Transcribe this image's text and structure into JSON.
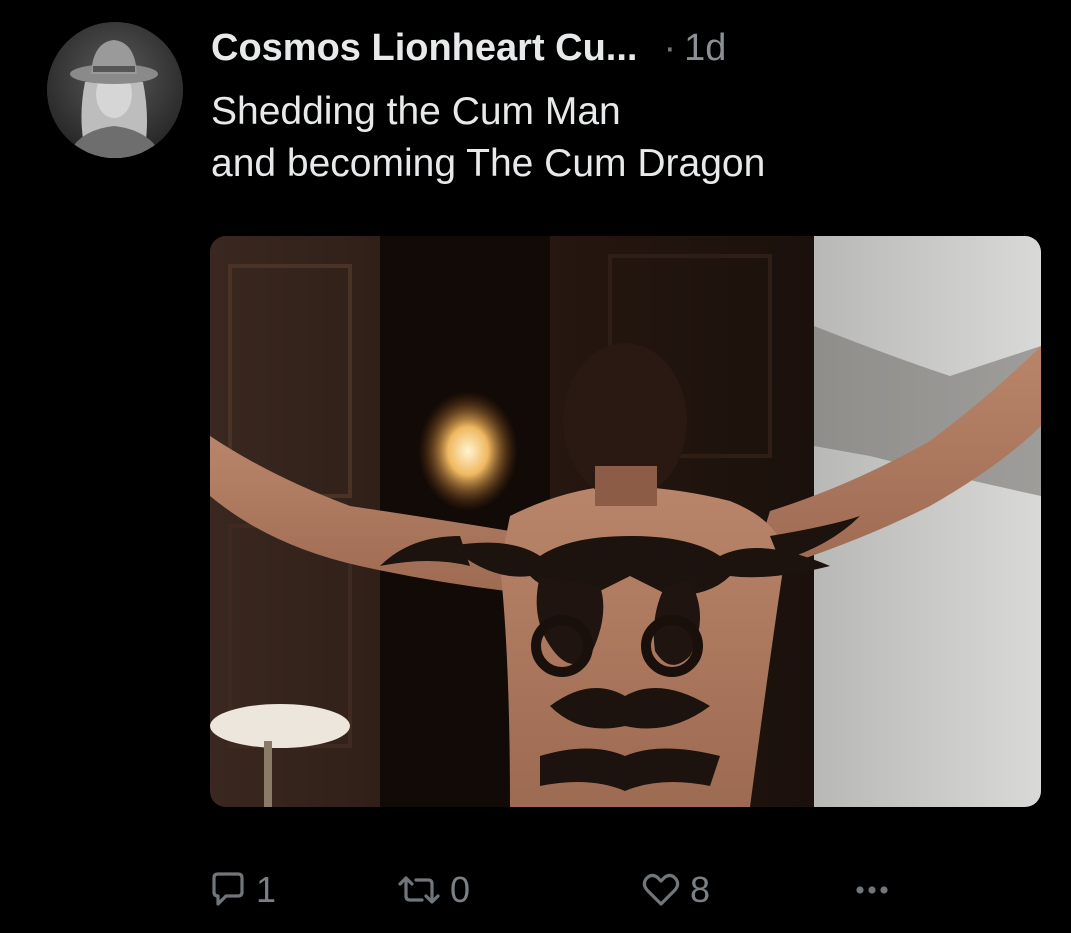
{
  "post": {
    "author": "Cosmos Lionheart Cu...",
    "separator": "·",
    "time": "1d",
    "text_lines": [
      "Shedding the Cum Man",
      "and becoming The Cum Dragon"
    ]
  },
  "media": {
    "description_icon": "photo"
  },
  "actions": {
    "reply": {
      "icon": "speech-bubble-icon",
      "count": "1"
    },
    "repost": {
      "icon": "repost-arrows-icon",
      "count": "0"
    },
    "like": {
      "icon": "heart-icon",
      "count": "8"
    },
    "more": {
      "icon": "more-dots-icon"
    }
  },
  "colors": {
    "background": "#000000",
    "text": "#e7e9ea",
    "muted": "#71767b"
  }
}
